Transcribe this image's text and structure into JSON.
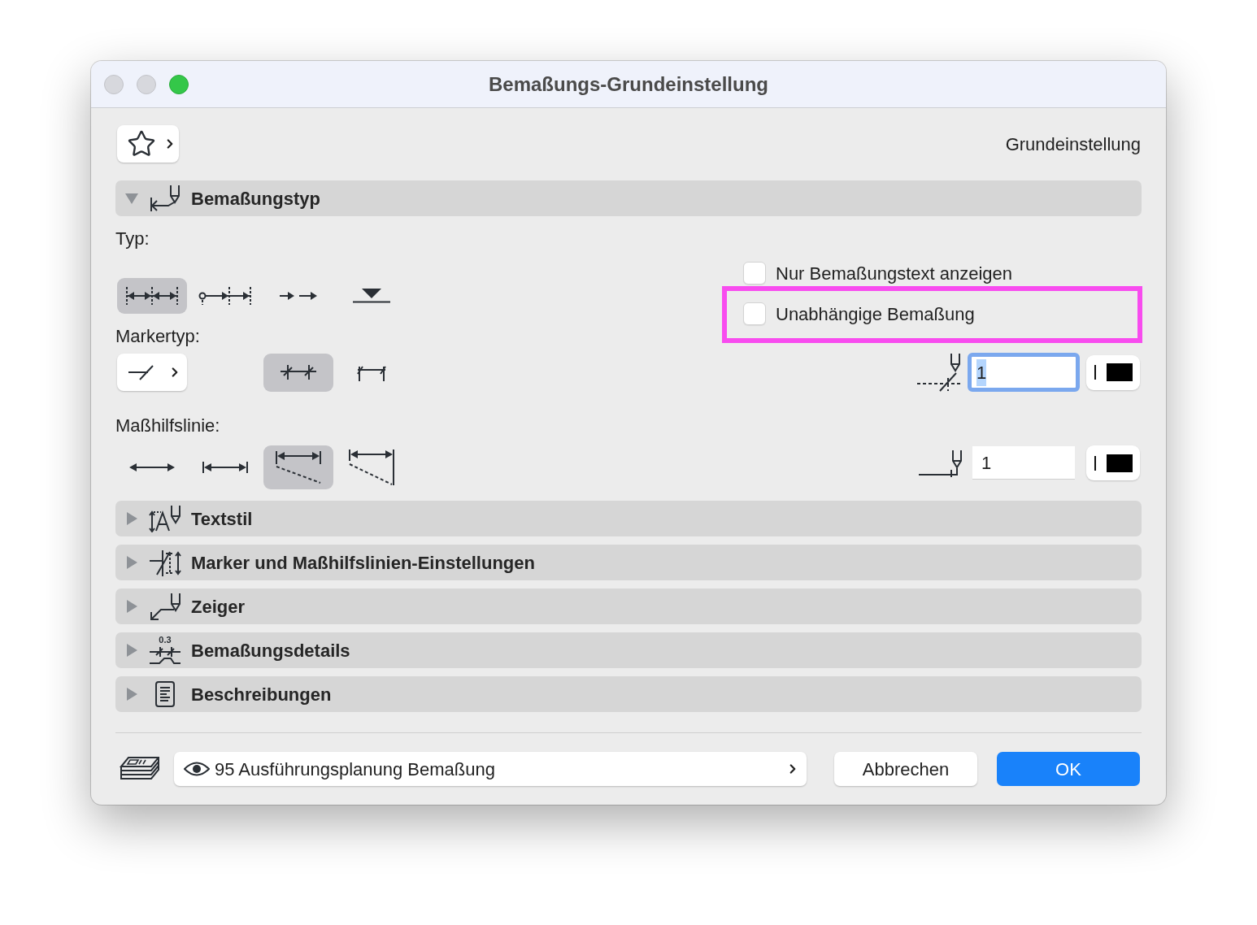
{
  "window": {
    "title": "Bemaßungs-Grundeinstellung",
    "controls": [
      {
        "disabled": true
      },
      {
        "disabled": true
      },
      {
        "disabled": false
      }
    ]
  },
  "preset": "Grundeinstellung",
  "panels": [
    {
      "title": "Bemaßungstyp",
      "expanded": true,
      "body": {
        "type": {
          "label": "Typ:",
          "options": [
            {
              "selected": true
            },
            {
              "selected": false
            },
            {
              "selected": false
            },
            {
              "selected": false
            }
          ]
        },
        "marker_type": {
          "label": "Markertyp:",
          "options": [
            {
              "selected": true
            },
            {
              "selected": false
            }
          ]
        },
        "witness_line": {
          "label": "Maßhilfslinie:",
          "options": [
            {
              "selected": false
            },
            {
              "selected": false
            },
            {
              "selected": true
            },
            {
              "selected": false
            }
          ]
        },
        "checkboxes": [
          {
            "label": "Nur Bemaßungstext anzeigen",
            "checked": false,
            "highlighted": false
          },
          {
            "label": "Unabhängige Bemaßung",
            "checked": false,
            "highlighted": true
          }
        ],
        "pen_fields": [
          {
            "value": "1",
            "focused": true
          },
          {
            "value": "1",
            "focused": false
          }
        ]
      }
    },
    {
      "title": "Textstil",
      "expanded": false
    },
    {
      "title": "Marker und Maßhilfslinien-Einstellungen",
      "expanded": false
    },
    {
      "title": "Zeiger",
      "expanded": false
    },
    {
      "title": "Bemaßungsdetails",
      "expanded": false,
      "icon_text": "0.3"
    },
    {
      "title": "Beschreibungen",
      "expanded": false
    }
  ],
  "layer": {
    "value": "95 Ausführungsplanung Bemaßung"
  },
  "buttons": [
    {
      "label": "Abbrechen",
      "kind": "secondary"
    },
    {
      "label": "OK",
      "kind": "primary"
    }
  ]
}
